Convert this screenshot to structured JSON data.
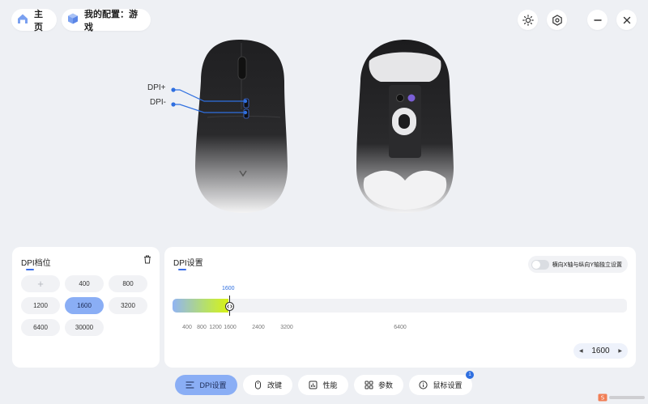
{
  "header": {
    "home_label": "主页",
    "config_label": "我的配置：游戏"
  },
  "mouse": {
    "callouts": [
      "DPI+",
      "DPI-"
    ]
  },
  "dpi_levels": {
    "title": "DPI档位",
    "buttons": [
      "+",
      "400",
      "800",
      "1200",
      "1600",
      "3200",
      "6400",
      "30000"
    ],
    "selected": "1600"
  },
  "dpi_settings": {
    "title": "DPI设置",
    "toggle_label": "横向X轴与纵向Y轴独立设置",
    "toggle_on": false,
    "slider_value_label": "1600",
    "slider_fraction": 0.123,
    "ticks": [
      "400",
      "800",
      "1200",
      "1600",
      "2400",
      "3200",
      "6400"
    ],
    "stepper_value": "1600"
  },
  "tabs": [
    {
      "label": "DPI设置",
      "active": true
    },
    {
      "label": "改键",
      "active": false
    },
    {
      "label": "性能",
      "active": false
    },
    {
      "label": "参数",
      "active": false
    },
    {
      "label": "鼠标设置",
      "active": false,
      "badge": "1"
    }
  ],
  "colors": {
    "accent": "#2f6fe0",
    "active_tab": "#8aaef5",
    "background": "#eef0f4"
  },
  "icons": [
    "home-icon",
    "cube-icon",
    "brightness-icon",
    "hexagon-settings-icon",
    "minimize-icon",
    "close-icon",
    "trash-icon",
    "chevron-left-icon",
    "chevron-right-icon",
    "dpi-icon",
    "mouse-icon",
    "chart-icon",
    "grid-icon",
    "info-icon"
  ]
}
